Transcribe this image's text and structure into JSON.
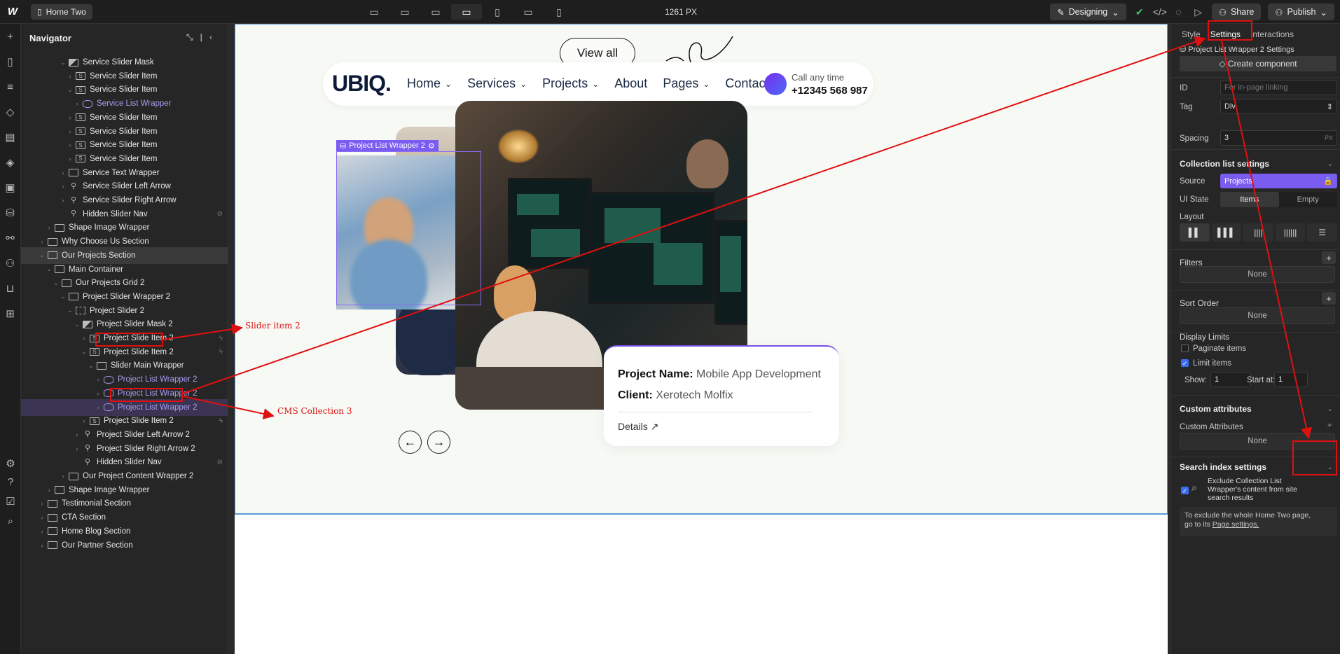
{
  "topbar": {
    "page_name": "Home Two",
    "width_readout": "1261 PX",
    "mode_label": "Designing",
    "share_label": "Share",
    "publish_label": "Publish"
  },
  "navigator": {
    "title": "Navigator",
    "rows": [
      {
        "label": "Service Slider Mask",
        "icon": "half",
        "indent": 3,
        "caret": "v"
      },
      {
        "label": "Service Slider Item",
        "icon": "S",
        "indent": 4,
        "caret": ">"
      },
      {
        "label": "Service Slider Item",
        "icon": "S",
        "indent": 4,
        "caret": "v"
      },
      {
        "label": "Service List Wrapper",
        "icon": "cms",
        "indent": 5,
        "caret": ">",
        "purple": true
      },
      {
        "label": "Service Slider Item",
        "icon": "S",
        "indent": 4,
        "caret": ">"
      },
      {
        "label": "Service Slider Item",
        "icon": "S",
        "indent": 4,
        "caret": ">"
      },
      {
        "label": "Service Slider Item",
        "icon": "S",
        "indent": 4,
        "caret": ">"
      },
      {
        "label": "Service Slider Item",
        "icon": "S",
        "indent": 4,
        "caret": ">"
      },
      {
        "label": "Service Text Wrapper",
        "icon": "box",
        "indent": 3,
        "caret": ">"
      },
      {
        "label": "Service Slider Left Arrow",
        "icon": "link",
        "indent": 3,
        "caret": ">"
      },
      {
        "label": "Service Slider Right Arrow",
        "icon": "link",
        "indent": 3,
        "caret": ">"
      },
      {
        "label": "Hidden Slider Nav",
        "icon": "link",
        "indent": 3,
        "caret": "",
        "hidden": true
      },
      {
        "label": "Shape Image Wrapper",
        "icon": "box",
        "indent": 1,
        "caret": ">"
      },
      {
        "label": "Why Choose Us Section",
        "icon": "section",
        "indent": 0,
        "caret": ">"
      },
      {
        "label": "Our Projects Section",
        "icon": "section",
        "indent": 0,
        "caret": "v",
        "selected": true
      },
      {
        "label": "Main Container",
        "icon": "container",
        "indent": 1,
        "caret": "v"
      },
      {
        "label": "Our Projects Grid 2",
        "icon": "box",
        "indent": 2,
        "caret": "v"
      },
      {
        "label": "Project Slider Wrapper 2",
        "icon": "box",
        "indent": 3,
        "caret": "v"
      },
      {
        "label": "Project Slider 2",
        "icon": "dashed",
        "indent": 4,
        "caret": "v"
      },
      {
        "label": "Project Slider Mask 2",
        "icon": "half",
        "indent": 5,
        "caret": "v"
      },
      {
        "label": "Project Slide Item 2",
        "icon": "S",
        "indent": 6,
        "caret": ">",
        "bolt": true
      },
      {
        "label": "Project Slide Item 2",
        "icon": "S",
        "indent": 6,
        "caret": "v",
        "bolt": true
      },
      {
        "label": "Slider Main Wrapper",
        "icon": "box",
        "indent": 7,
        "caret": "v"
      },
      {
        "label": "Project List Wrapper 2",
        "icon": "cms",
        "indent": 8,
        "caret": ">",
        "purple": true
      },
      {
        "label": "Project List Wrapper 2",
        "icon": "cms",
        "indent": 8,
        "caret": ">",
        "purple": true
      },
      {
        "label": "Project List Wrapper 2",
        "icon": "cms",
        "indent": 8,
        "caret": ">",
        "purple": true,
        "highlight": true
      },
      {
        "label": "Project Slide Item 2",
        "icon": "S",
        "indent": 6,
        "caret": ">",
        "bolt": true
      },
      {
        "label": "Project Slider Left Arrow 2",
        "icon": "link",
        "indent": 5,
        "caret": ">"
      },
      {
        "label": "Project Slider Right Arrow 2",
        "icon": "link",
        "indent": 5,
        "caret": ">"
      },
      {
        "label": "Hidden Slider Nav",
        "icon": "link",
        "indent": 5,
        "caret": "",
        "hidden": true
      },
      {
        "label": "Our Project Content Wrapper 2",
        "icon": "box",
        "indent": 3,
        "caret": ">"
      },
      {
        "label": "Shape Image Wrapper",
        "icon": "box",
        "indent": 1,
        "caret": ">"
      },
      {
        "label": "Testimonial Section",
        "icon": "section",
        "indent": 0,
        "caret": ">"
      },
      {
        "label": "CTA Section",
        "icon": "section",
        "indent": 0,
        "caret": ">"
      },
      {
        "label": "Home Blog Section",
        "icon": "section",
        "indent": 0,
        "caret": ">"
      },
      {
        "label": "Our Partner Section",
        "icon": "section",
        "indent": 0,
        "caret": ">"
      }
    ]
  },
  "canvas": {
    "view_all": "View all",
    "brand": "UBIQ.",
    "nav_links": [
      "Home",
      "Services",
      "Projects",
      "About",
      "Pages",
      "Contact"
    ],
    "call_label": "Call any time",
    "call_number": "+12345 568 987",
    "selection_badge": "Project List Wrapper 2",
    "card_name_key": "Project Name:",
    "card_name_val": "Mobile App Development",
    "card_client_key": "Client:",
    "card_client_val": "Xerotech Molfix",
    "card_details": "Details",
    "annot_slider": "Slider item 2",
    "annot_cms": "CMS Collection 3"
  },
  "settings": {
    "tabs": [
      "Style",
      "Settings",
      "Interactions"
    ],
    "element_title": "Project List Wrapper 2 Settings",
    "create_component": "Create component",
    "id_label": "ID",
    "id_placeholder": "For in-page linking",
    "tag_label": "Tag",
    "tag_value": "Div",
    "spacing_label": "Spacing",
    "spacing_value": "3",
    "spacing_unit": "PX",
    "collection_head": "Collection list settings",
    "source_label": "Source",
    "source_value": "Projects",
    "ui_state_label": "UI State",
    "ui_items": "Items",
    "ui_empty": "Empty",
    "layout_label": "Layout",
    "filters_label": "Filters",
    "none": "None",
    "sort_label": "Sort Order",
    "display_limits": "Display Limits",
    "paginate": "Paginate items",
    "limit": "Limit items",
    "show_label": "Show:",
    "show_value": "1",
    "start_label": "Start at:",
    "start_value": "1",
    "custom_attr_head": "Custom attributes",
    "custom_attr_label": "Custom Attributes",
    "search_head": "Search index settings",
    "exclude_text": "Exclude Collection List Wrapper's content from site search results",
    "exclude_note_1": "To exclude the whole Home Two page,",
    "exclude_note_2": "go to its",
    "page_settings_link": "Page settings."
  },
  "colors": {
    "accent_red": "#e01010",
    "purple": "#7a5cf0",
    "blue_check": "#3a6cf0"
  }
}
